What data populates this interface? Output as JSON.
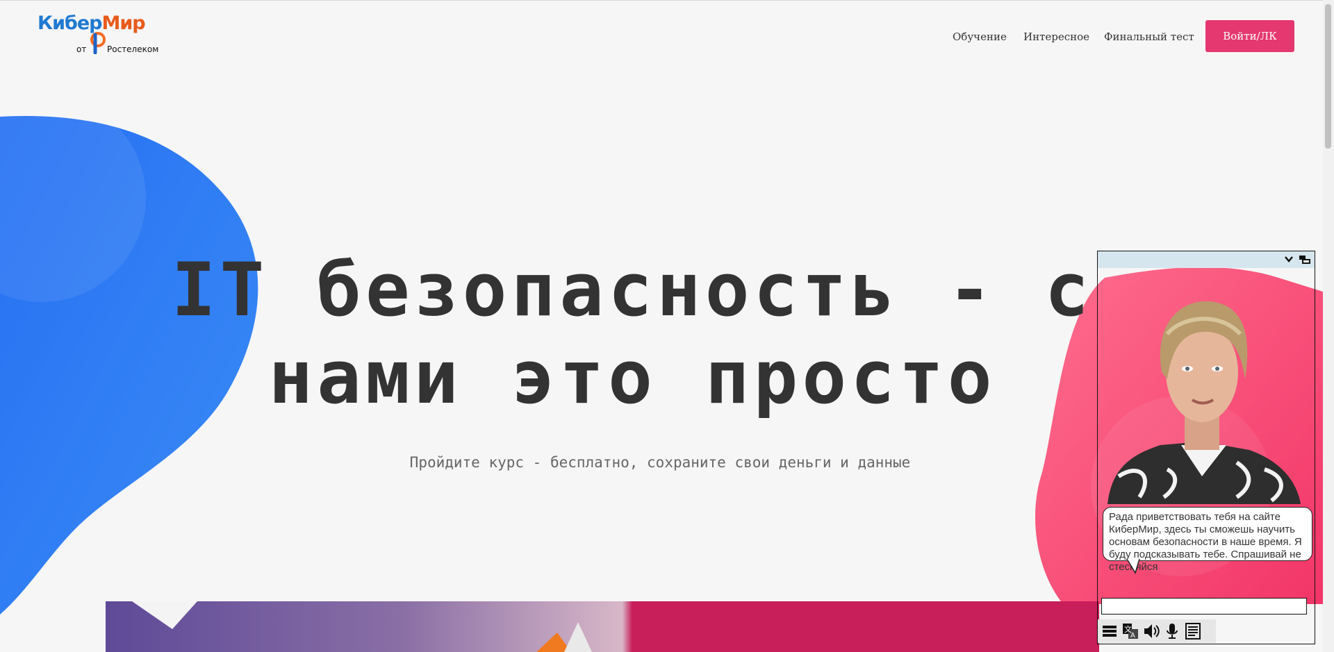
{
  "header": {
    "logo": {
      "word_part1": "Кибер",
      "word_part2": "Мир",
      "from": "от",
      "brand": "Ростелеком"
    },
    "nav": [
      {
        "label": "Обучение"
      },
      {
        "label": "Интересное"
      },
      {
        "label": "Финальный тест"
      }
    ],
    "login_label": "Войти/ЛК"
  },
  "hero": {
    "title_line1": "IT безопасность - с",
    "title_line2": "нами это просто",
    "subtitle": "Пройдите курс - бесплатно, сохраните свои деньги и данные"
  },
  "assistant": {
    "message": "Рада приветствовать тебя на сайте КиберМир, здесь ты сможешь научить основам безопасности в наше время. Я буду подсказывать тебе. Спрашивай не стесняйся",
    "input_value": "",
    "tools": [
      "menu-icon",
      "translate-icon",
      "speaker-icon",
      "microphone-icon",
      "transcript-icon"
    ]
  },
  "colors": {
    "accent": "#e53870",
    "blue_blob": "#2f7bf4",
    "pink_blob": "#f43f70",
    "text": "#333333"
  }
}
